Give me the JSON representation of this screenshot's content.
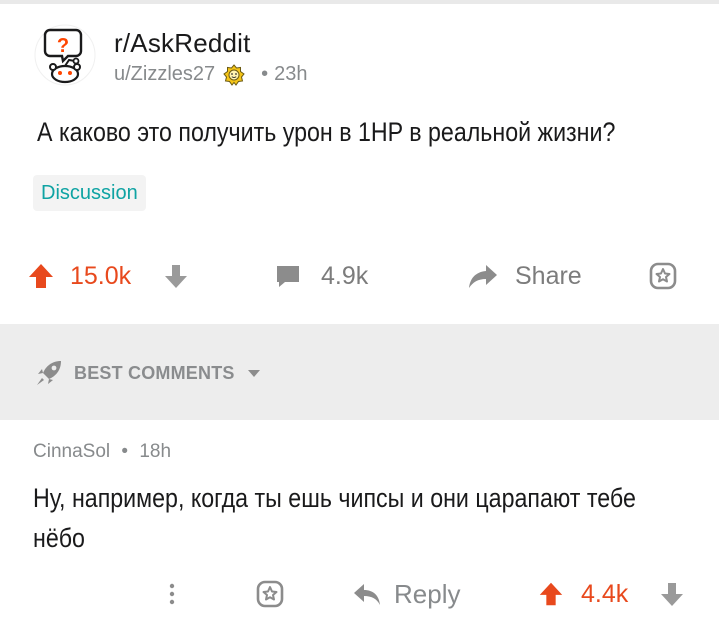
{
  "post": {
    "subreddit": "r/AskReddit",
    "author": "u/Zizzles27",
    "separator": "•",
    "age": "23h",
    "title": "А каково это получить урон в 1HP в реальной жизни?",
    "flair": "Discussion",
    "flair_color": "#0fa3a3"
  },
  "post_actions": {
    "upvotes": "15.0k",
    "comments": "4.9k",
    "share_label": "Share",
    "upvote_color": "#e8491d"
  },
  "sort": {
    "label": "BEST COMMENTS"
  },
  "comment": {
    "author": "CinnaSol",
    "separator": "•",
    "age": "18h",
    "body_line1": "Ну, например, когда ты ешь чипсы и они царапают тебе",
    "body_line2": "нёбо",
    "reply_label": "Reply",
    "upvotes": "4.4k"
  },
  "icons": {
    "subreddit_avatar": "askreddit-snoo-icon",
    "award": "award-icon",
    "upvote": "upvote-arrow-icon",
    "downvote": "downvote-arrow-icon",
    "comments": "comment-bubble-icon",
    "share": "share-arrow-icon",
    "save": "award-outline-icon",
    "sort": "rocket-icon",
    "more": "more-vertical-icon",
    "reply": "reply-arrow-icon"
  }
}
